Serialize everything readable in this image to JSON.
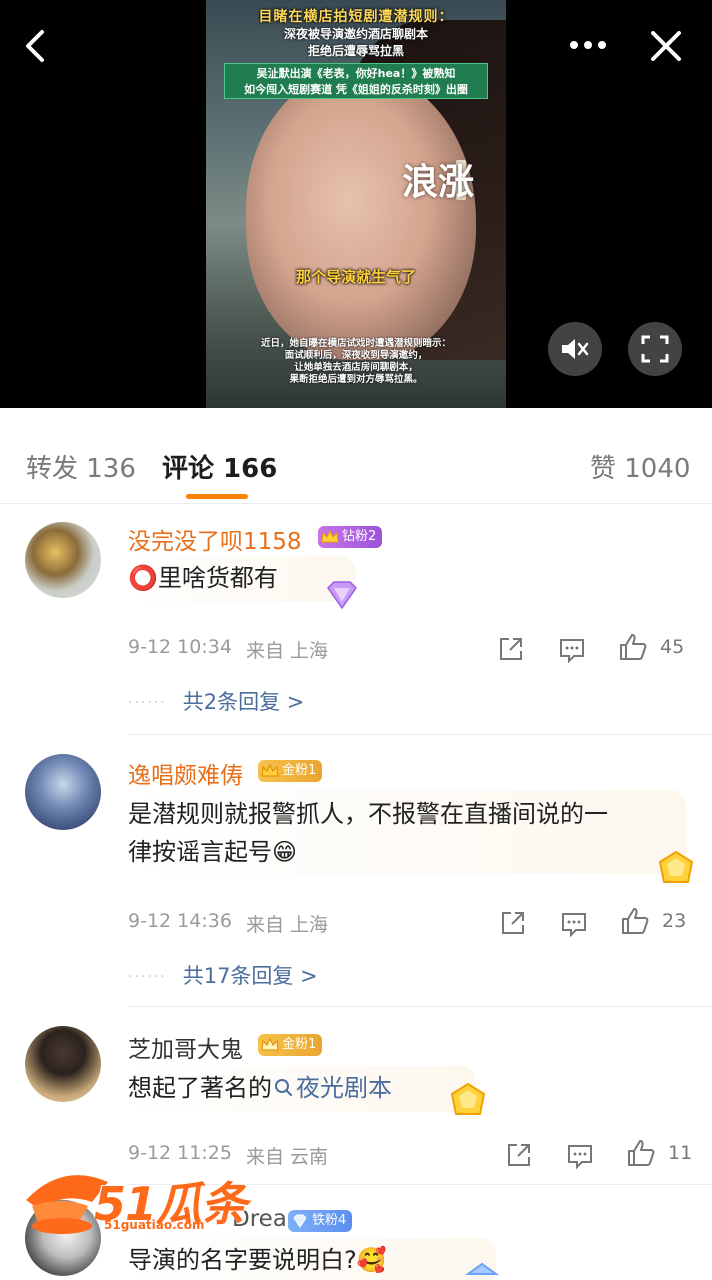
{
  "video": {
    "title_line1": "目睹在横店拍短剧遭潜规则：",
    "title_line2": "深夜被导演邀约酒店聊剧本",
    "title_line3": "拒绝后遭辱骂拉黑",
    "green_line1": "吴沚默出演《老表，你好hea！》被熟知",
    "green_line2": "如今闯入短剧赛道 凭《姐姐的反杀时刻》出圈",
    "logo_text": "浪涨",
    "subtitle": "那个导演就生气了",
    "caption_line1": "近日，她自曝在横店试戏时遭遇潜规则暗示：",
    "caption_line2": "面试顺利后，深夜收到导演邀约，",
    "caption_line3": "让她单独去酒店房间聊剧本，",
    "caption_line4": "果断拒绝后遭到对方辱骂拉黑。"
  },
  "tabs": {
    "repost": "转发 136",
    "comment": "评论 166",
    "like": "赞 1040",
    "accent": "#ff8200"
  },
  "comments": [
    {
      "username": "没完没了呗1158",
      "badge": "钻粉2",
      "text": "⭕里啥货都有",
      "time": "9-12 10:34",
      "from": "来自 上海",
      "likes": "45",
      "replies": "共2条回复 >"
    },
    {
      "username": "逸唱颇难俦",
      "badge": "金粉1",
      "text_line1": "是潜规则就报警抓人，不报警在直播间说的一",
      "text_line2": "律按谣言起号😁",
      "time": "9-12 14:36",
      "from": "来自 上海",
      "likes": "23",
      "replies": "共17条回复 >"
    },
    {
      "username": "芝加哥大鬼",
      "badge": "金粉1",
      "text_prefix": "想起了著名的",
      "text_link": "夜光剧本",
      "time": "9-12 11:25",
      "from": "来自 云南",
      "likes": "11"
    },
    {
      "username": "Dream",
      "badge": "铁粉4",
      "text": "导演的名字要说明白?🥰"
    }
  ],
  "watermark": {
    "brand": "51瓜条",
    "url": "51guatiao.com"
  }
}
